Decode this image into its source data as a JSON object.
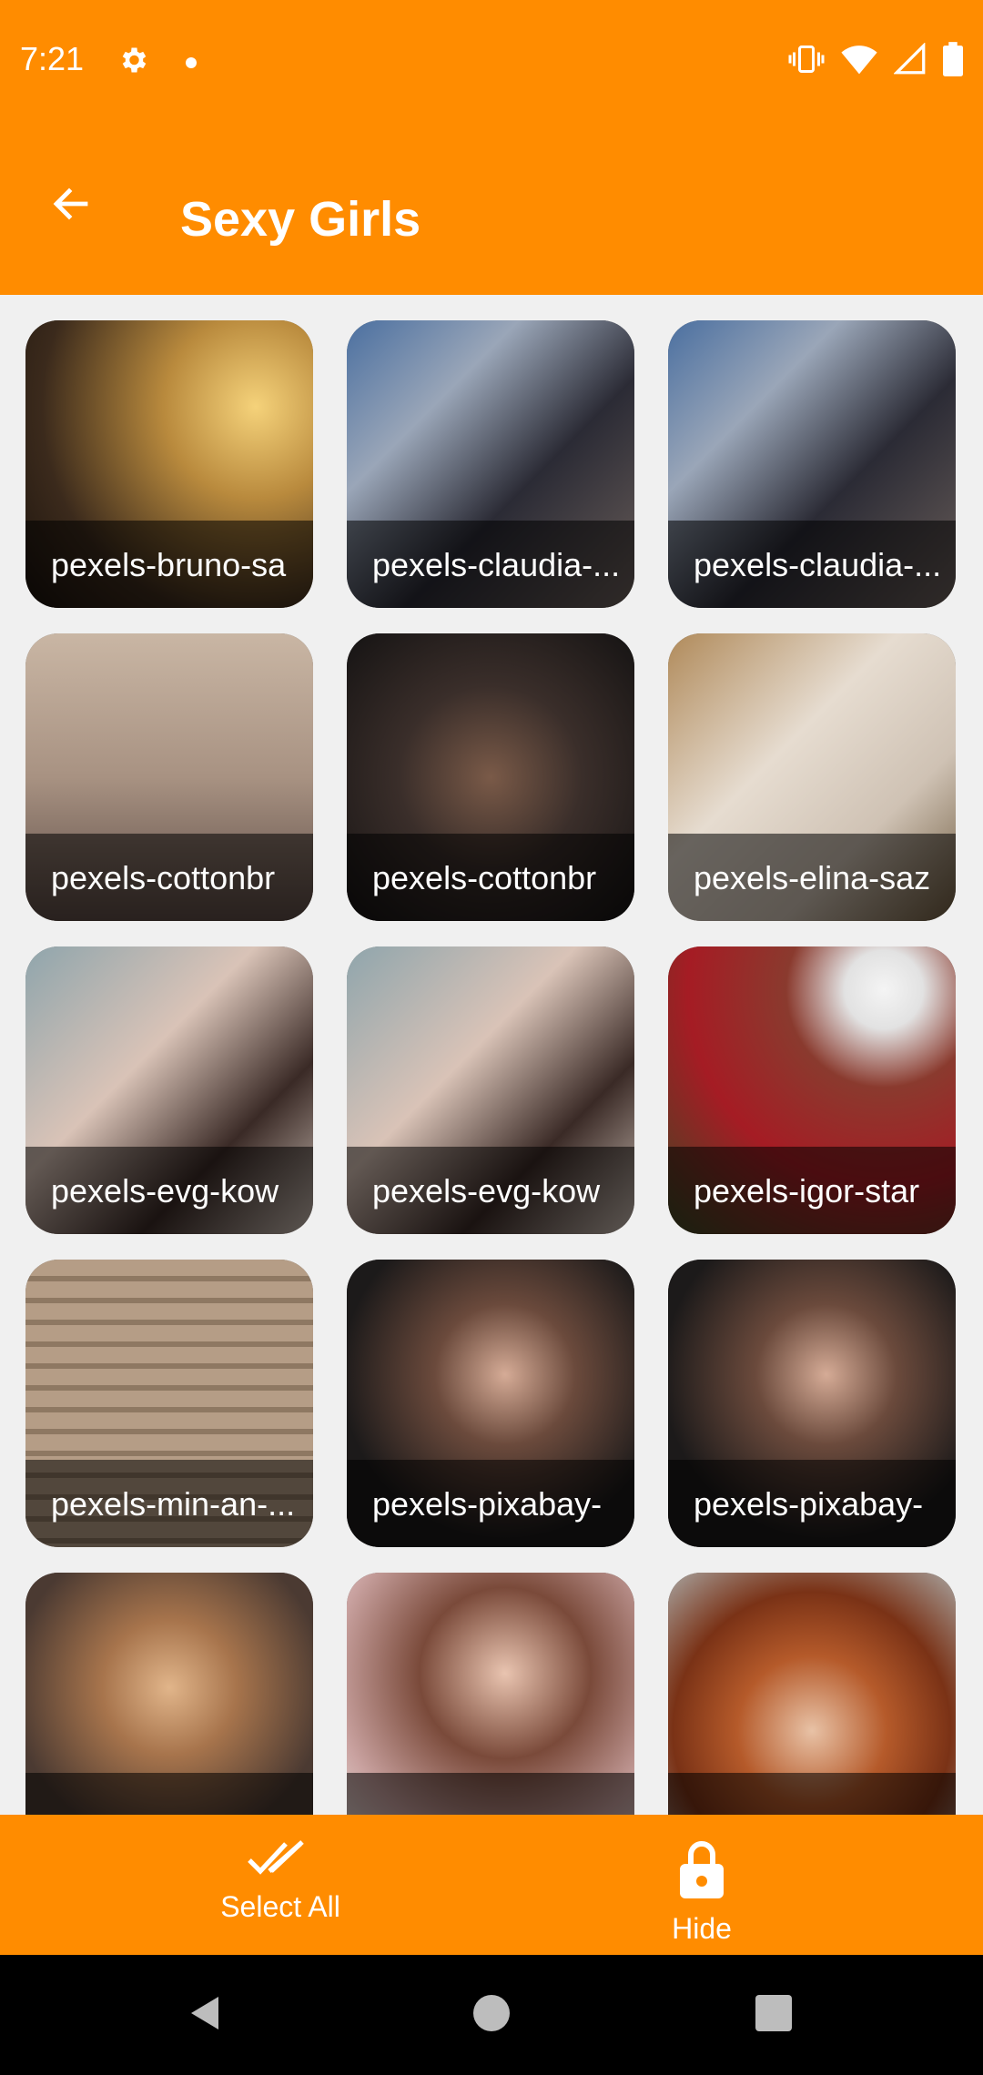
{
  "status_bar": {
    "time": "7:21",
    "icons": [
      "settings-gear-icon",
      "notification-dot-icon",
      "vibrate-icon",
      "wifi-icon",
      "signal-icon",
      "battery-icon"
    ]
  },
  "app_bar": {
    "title": "Sexy Girls",
    "back_icon": "arrow-left-icon"
  },
  "gallery": {
    "items": [
      {
        "label": "pexels-bruno-sa"
      },
      {
        "label": "pexels-claudia-..."
      },
      {
        "label": "pexels-claudia-..."
      },
      {
        "label": "pexels-cottonbr"
      },
      {
        "label": "pexels-cottonbr"
      },
      {
        "label": "pexels-elina-saz"
      },
      {
        "label": "pexels-evg-kow"
      },
      {
        "label": "pexels-evg-kow"
      },
      {
        "label": "pexels-igor-star"
      },
      {
        "label": "pexels-min-an-..."
      },
      {
        "label": "pexels-pixabay-"
      },
      {
        "label": "pexels-pixabay-"
      },
      {
        "label": ""
      },
      {
        "label": ""
      },
      {
        "label": ""
      }
    ]
  },
  "bottom_actions": {
    "select_all": {
      "label": "Select All",
      "icon": "double-check-icon"
    },
    "hide": {
      "label": "Hide",
      "icon": "lock-icon"
    }
  },
  "colors": {
    "accent": "#ff8c00",
    "background": "#f0f0f0",
    "nav_bar": "#000000"
  }
}
